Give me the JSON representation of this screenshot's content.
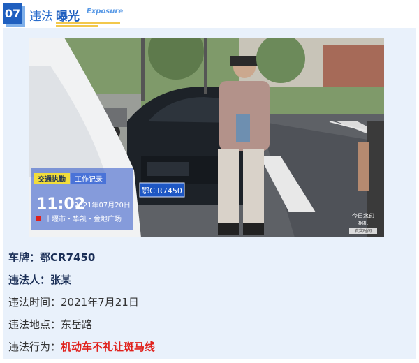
{
  "header": {
    "number": "07",
    "title_part1": "违法",
    "title_part2": "曝光",
    "subtitle": "Exposure"
  },
  "photo": {
    "watermark_tag": "交通执勤",
    "watermark_tag2": "工作记录",
    "time": "11:02",
    "date": "2021年07月20日",
    "location": "十堰市・华凯・金地广场",
    "plate_on_car": "鄂C·R7450",
    "corner_mark_1": "今日水印",
    "corner_mark_2": "相机",
    "corner_mark_3": "真实时间"
  },
  "info": {
    "plate_label": "车牌：",
    "plate_value": "鄂CR7450",
    "violator_label": "违法人：",
    "violator_value": "张某",
    "time_label": "违法时间：",
    "time_value": "2021年7月21日",
    "place_label": "违法地点：",
    "place_value": "东岳路",
    "act_label": "违法行为：",
    "act_value": "机动车不礼让斑马线"
  }
}
